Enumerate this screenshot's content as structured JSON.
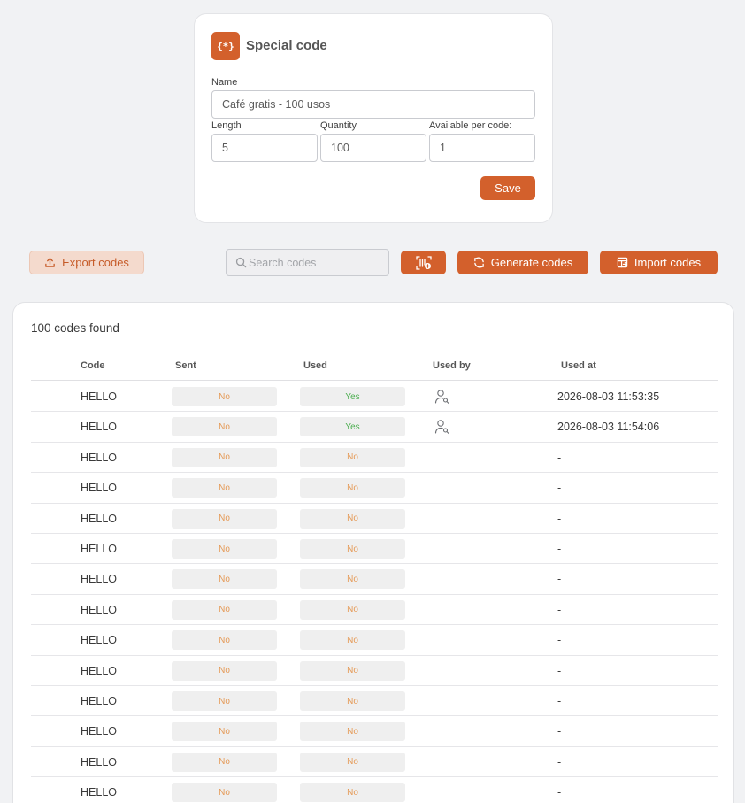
{
  "form": {
    "title": "Special code",
    "icon": "braces-asterisk-icon",
    "icon_glyph": "{*}",
    "name_label": "Name",
    "name_value": "Café gratis - 100 usos",
    "length_label": "Length",
    "length_value": "5",
    "quantity_label": "Quantity",
    "quantity_value": "100",
    "available_label": "Available per code:",
    "available_value": "1",
    "save_label": "Save"
  },
  "toolbar": {
    "export_label": "Export codes",
    "search_placeholder": "Search codes",
    "generate_label": "Generate codes",
    "import_label": "Import codes"
  },
  "table": {
    "found_text": "100 codes found",
    "columns": [
      "Code",
      "Sent",
      "Used",
      "Used by",
      "Used at"
    ],
    "rows": [
      {
        "code": "HELLO",
        "sent": "No",
        "used": "Yes",
        "used_by": "user-search-icon",
        "used_at": "2026-08-03 11:53:35"
      },
      {
        "code": "HELLO",
        "sent": "No",
        "used": "Yes",
        "used_by": "user-search-icon",
        "used_at": "2026-08-03 11:54:06"
      },
      {
        "code": "HELLO",
        "sent": "No",
        "used": "No",
        "used_by": "",
        "used_at": "-"
      },
      {
        "code": "HELLO",
        "sent": "No",
        "used": "No",
        "used_by": "",
        "used_at": "-"
      },
      {
        "code": "HELLO",
        "sent": "No",
        "used": "No",
        "used_by": "",
        "used_at": "-"
      },
      {
        "code": "HELLO",
        "sent": "No",
        "used": "No",
        "used_by": "",
        "used_at": "-"
      },
      {
        "code": "HELLO",
        "sent": "No",
        "used": "No",
        "used_by": "",
        "used_at": "-"
      },
      {
        "code": "HELLO",
        "sent": "No",
        "used": "No",
        "used_by": "",
        "used_at": "-"
      },
      {
        "code": "HELLO",
        "sent": "No",
        "used": "No",
        "used_by": "",
        "used_at": "-"
      },
      {
        "code": "HELLO",
        "sent": "No",
        "used": "No",
        "used_by": "",
        "used_at": "-"
      },
      {
        "code": "HELLO",
        "sent": "No",
        "used": "No",
        "used_by": "",
        "used_at": "-"
      },
      {
        "code": "HELLO",
        "sent": "No",
        "used": "No",
        "used_by": "",
        "used_at": "-"
      },
      {
        "code": "HELLO",
        "sent": "No",
        "used": "No",
        "used_by": "",
        "used_at": "-"
      },
      {
        "code": "HELLO",
        "sent": "No",
        "used": "No",
        "used_by": "",
        "used_at": "-"
      }
    ]
  },
  "colors": {
    "accent": "#d3602c",
    "accent_light": "#f4dacd",
    "no_text": "#e59a57",
    "yes_text": "#4caf50",
    "background": "#f1f2f4"
  }
}
